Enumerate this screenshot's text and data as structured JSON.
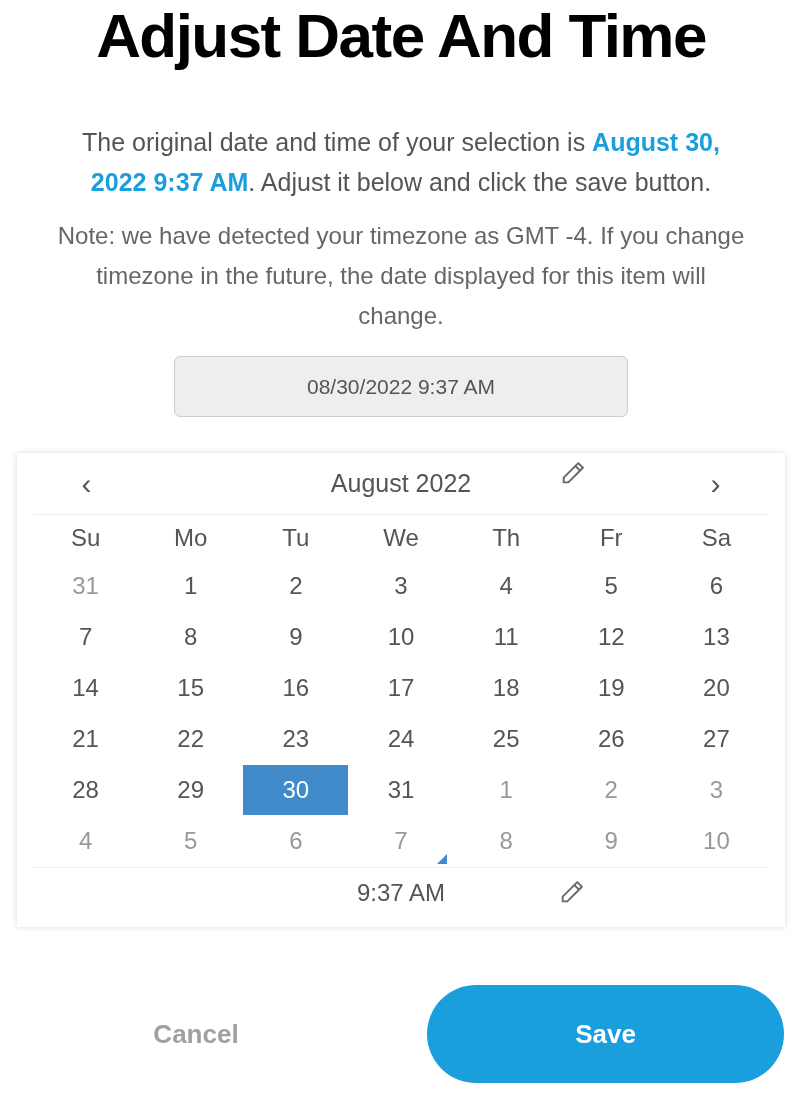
{
  "title": "Adjust Date And Time",
  "intro": {
    "before": "The original date and time of your selection is ",
    "highlight": "August 30, 2022 9:37 AM",
    "after": ". Adjust it below and click the save button."
  },
  "note": "Note: we have detected your timezone as GMT -4. If you change timezone in the future, the date displayed for this item will change.",
  "date_field": {
    "value": "08/30/2022 9:37 AM"
  },
  "calendar": {
    "prev": "‹",
    "month": "August 2022",
    "next": "›",
    "weekdays": [
      "Su",
      "Mo",
      "Tu",
      "We",
      "Th",
      "Fr",
      "Sa"
    ],
    "weeks": [
      [
        {
          "label": "31",
          "outside": true,
          "selected": false
        },
        {
          "label": "1",
          "outside": false,
          "selected": false
        },
        {
          "label": "2",
          "outside": false,
          "selected": false
        },
        {
          "label": "3",
          "outside": false,
          "selected": false
        },
        {
          "label": "4",
          "outside": false,
          "selected": false
        },
        {
          "label": "5",
          "outside": false,
          "selected": false
        },
        {
          "label": "6",
          "outside": false,
          "selected": false
        }
      ],
      [
        {
          "label": "7",
          "outside": false,
          "selected": false
        },
        {
          "label": "8",
          "outside": false,
          "selected": false
        },
        {
          "label": "9",
          "outside": false,
          "selected": false
        },
        {
          "label": "10",
          "outside": false,
          "selected": false
        },
        {
          "label": "11",
          "outside": false,
          "selected": false
        },
        {
          "label": "12",
          "outside": false,
          "selected": false
        },
        {
          "label": "13",
          "outside": false,
          "selected": false
        }
      ],
      [
        {
          "label": "14",
          "outside": false,
          "selected": false
        },
        {
          "label": "15",
          "outside": false,
          "selected": false
        },
        {
          "label": "16",
          "outside": false,
          "selected": false
        },
        {
          "label": "17",
          "outside": false,
          "selected": false
        },
        {
          "label": "18",
          "outside": false,
          "selected": false
        },
        {
          "label": "19",
          "outside": false,
          "selected": false
        },
        {
          "label": "20",
          "outside": false,
          "selected": false
        }
      ],
      [
        {
          "label": "21",
          "outside": false,
          "selected": false
        },
        {
          "label": "22",
          "outside": false,
          "selected": false
        },
        {
          "label": "23",
          "outside": false,
          "selected": false
        },
        {
          "label": "24",
          "outside": false,
          "selected": false
        },
        {
          "label": "25",
          "outside": false,
          "selected": false
        },
        {
          "label": "26",
          "outside": false,
          "selected": false
        },
        {
          "label": "27",
          "outside": false,
          "selected": false
        }
      ],
      [
        {
          "label": "28",
          "outside": false,
          "selected": false
        },
        {
          "label": "29",
          "outside": false,
          "selected": false
        },
        {
          "label": "30",
          "outside": false,
          "selected": true
        },
        {
          "label": "31",
          "outside": false,
          "selected": false
        },
        {
          "label": "1",
          "outside": true,
          "selected": false
        },
        {
          "label": "2",
          "outside": true,
          "selected": false
        },
        {
          "label": "3",
          "outside": true,
          "selected": false
        }
      ],
      [
        {
          "label": "4",
          "outside": true,
          "selected": false
        },
        {
          "label": "5",
          "outside": true,
          "selected": false
        },
        {
          "label": "6",
          "outside": true,
          "selected": false
        },
        {
          "label": "7",
          "outside": true,
          "selected": false
        },
        {
          "label": "8",
          "outside": true,
          "selected": false
        },
        {
          "label": "9",
          "outside": true,
          "selected": false
        },
        {
          "label": "10",
          "outside": true,
          "selected": false
        }
      ]
    ],
    "time": "9:37 AM"
  },
  "buttons": {
    "cancel": "Cancel",
    "save": "Save"
  }
}
